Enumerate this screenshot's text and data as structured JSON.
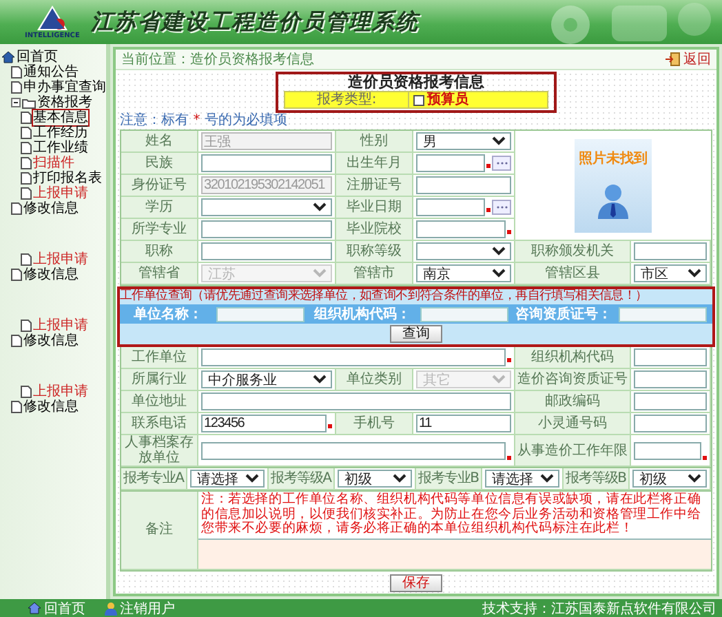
{
  "header": {
    "title": "江苏省建设工程造价员管理系统",
    "logo_text": "INTELLIGENCE"
  },
  "sidebar": {
    "items": [
      {
        "label": "回首页",
        "kind": "home",
        "selected": false,
        "color": "#000000",
        "children": [
          {
            "label": "通知公告",
            "kind": "page",
            "selected": false,
            "color": "#000000"
          },
          {
            "label": "申办事宜查询",
            "kind": "page",
            "selected": false,
            "color": "#000000"
          },
          {
            "label": "资格报考",
            "kind": "folder",
            "expanded": true,
            "selected": false,
            "color": "#000000",
            "children": [
              {
                "label": "基本信息",
                "kind": "page",
                "selected": true,
                "color": "#000000"
              },
              {
                "label": "工作经历",
                "kind": "page",
                "selected": false,
                "color": "#000000"
              },
              {
                "label": "工作业绩",
                "kind": "page",
                "selected": false,
                "color": "#000000"
              },
              {
                "label": "扫描件",
                "kind": "page",
                "selected": false,
                "color": "#cc2222"
              },
              {
                "label": "打印报名表",
                "kind": "page",
                "selected": false,
                "color": "#000000"
              },
              {
                "label": "上报申请",
                "kind": "page",
                "selected": false,
                "color": "#cc2222"
              }
            ]
          },
          {
            "label": "修改信息",
            "kind": "page",
            "selected": false,
            "color": "#000000"
          }
        ]
      }
    ],
    "groups": [
      [
        {
          "children": [
            {
              "label": "上报申请",
              "kind": "page",
              "selected": false,
              "color": "#cc2222"
            }
          ]
        },
        {
          "label": "修改信息",
          "kind": "page",
          "selected": false,
          "color": "#000000"
        }
      ],
      [
        {
          "children": [
            {
              "label": "上报申请",
              "kind": "page",
              "selected": false,
              "color": "#cc2222"
            }
          ]
        },
        {
          "label": "修改信息",
          "kind": "page",
          "selected": false,
          "color": "#000000"
        }
      ],
      [
        {
          "children": [
            {
              "label": "上报申请",
              "kind": "page",
              "selected": false,
              "color": "#cc2222"
            }
          ]
        },
        {
          "label": "修改信息",
          "kind": "page",
          "selected": false,
          "color": "#000000"
        }
      ]
    ]
  },
  "breadcrumb": {
    "text": "当前位置：造价员资格报考信息",
    "back": "返回"
  },
  "form": {
    "title": "造价员资格报考信息",
    "exam_type": {
      "label": "报考类型:",
      "option": "预算员",
      "checked": false
    },
    "note": {
      "before": "注意：标有",
      "mark": "*",
      "after": "号的为必填项"
    },
    "photo": {
      "text": "照片未找到"
    },
    "upper_rows": [
      [
        {
          "label": "姓名",
          "field": {
            "kind": "text",
            "value": "王强",
            "disabled": true
          }
        },
        {
          "label": "性别",
          "field": {
            "kind": "select",
            "value": "男",
            "disabled": false
          }
        }
      ],
      [
        {
          "label": "民族",
          "field": {
            "kind": "text",
            "disabled": false
          }
        },
        {
          "label": "出生年月",
          "field": {
            "kind": "date",
            "disabled": false,
            "required": true
          }
        }
      ],
      [
        {
          "label": "身份证号",
          "field": {
            "kind": "text",
            "value": "320102195302142051",
            "disabled": true
          }
        },
        {
          "label": "注册证号",
          "field": {
            "kind": "text",
            "disabled": false
          }
        }
      ],
      [
        {
          "label": "学历",
          "field": {
            "kind": "select",
            "disabled": false
          }
        },
        {
          "label": "毕业日期",
          "field": {
            "kind": "date",
            "disabled": false,
            "required": true
          }
        }
      ],
      [
        {
          "label": "所学专业",
          "field": {
            "kind": "text",
            "disabled": false
          }
        },
        {
          "label": "毕业院校",
          "field": {
            "kind": "text",
            "disabled": false,
            "required": true
          }
        }
      ],
      [
        {
          "label": "职称",
          "field": {
            "kind": "text",
            "disabled": false
          }
        },
        {
          "label": "职称等级",
          "field": {
            "kind": "select",
            "disabled": false
          }
        },
        {
          "label": "职称颁发机关",
          "field": {
            "kind": "text",
            "disabled": false
          }
        }
      ],
      [
        {
          "label": "管辖省",
          "field": {
            "kind": "select",
            "value": "江苏",
            "disabled": true
          }
        },
        {
          "label": "管辖市",
          "field": {
            "kind": "select",
            "value": "南京",
            "disabled": false
          }
        },
        {
          "label": "管辖区县",
          "field": {
            "kind": "select",
            "value": "市区",
            "disabled": false
          }
        }
      ]
    ],
    "search": {
      "title": "工作单位查询（请优先通过查询来选择单位，如查询不到符合条件的单位，再自行填写相关信息！）",
      "fields": [
        "单位名称：",
        "组织机构代码：",
        "咨询资质证号："
      ],
      "button": "查询"
    },
    "lower_rows": [
      [
        {
          "label": "工作单位",
          "field": {
            "kind": "text",
            "disabled": false,
            "required": true
          }
        },
        {
          "label": "组织机构代码",
          "field": {
            "kind": "text",
            "disabled": false
          }
        }
      ],
      [
        {
          "label": "所属行业",
          "field": {
            "kind": "select",
            "value": "中介服务业",
            "disabled": false
          }
        },
        {
          "label": "单位类别",
          "field": {
            "kind": "select",
            "value": "其它",
            "disabled": true
          }
        },
        {
          "label": "造价咨询资质证号",
          "field": {
            "kind": "text",
            "disabled": false
          }
        }
      ],
      [
        {
          "label": "单位地址",
          "field": {
            "kind": "text",
            "disabled": false
          }
        },
        {
          "label": "邮政编码",
          "field": {
            "kind": "text",
            "disabled": false
          }
        }
      ],
      [
        {
          "label": "联系电话",
          "field": {
            "kind": "text",
            "value": "123456",
            "disabled": false,
            "required": true
          }
        },
        {
          "label": "手机号",
          "field": {
            "kind": "text",
            "value": "11",
            "disabled": false
          }
        },
        {
          "label": "小灵通号码",
          "field": {
            "kind": "text",
            "disabled": false
          }
        }
      ],
      [
        {
          "label": "人事档案存放单位",
          "field": {
            "kind": "text",
            "disabled": false,
            "required": true
          }
        },
        {
          "label": "从事造价工作年限",
          "field": {
            "kind": "text",
            "disabled": false,
            "required": true
          }
        }
      ]
    ],
    "exam_row": [
      {
        "label": "报考专业A",
        "field": {
          "kind": "select",
          "value": "请选择",
          "disabled": false
        }
      },
      {
        "label": "报考等级A",
        "field": {
          "kind": "select",
          "value": "初级",
          "disabled": false
        }
      },
      {
        "label": "报考专业B",
        "field": {
          "kind": "select",
          "value": "请选择",
          "disabled": false
        }
      },
      {
        "label": "报考等级B",
        "field": {
          "kind": "select",
          "value": "初级",
          "disabled": false
        }
      }
    ],
    "remarks": {
      "label": "备注",
      "note": "注：若选择的工作单位名称、组织机构代码等单位信息有误或缺项，请在此栏将正确的信息加以说明，以便我们核实补正。为防止在您今后业务活动和资格管理工作中给您带来不必要的麻烦，请务必将正确的本单位组织机构代码标注在此栏！"
    },
    "save": "保存"
  },
  "footer": {
    "links": [
      {
        "label": "回首页",
        "kind": "home"
      },
      {
        "label": "注销用户",
        "kind": "user"
      }
    ],
    "support": "技术支持：江苏国泰新点软件有限公司"
  }
}
